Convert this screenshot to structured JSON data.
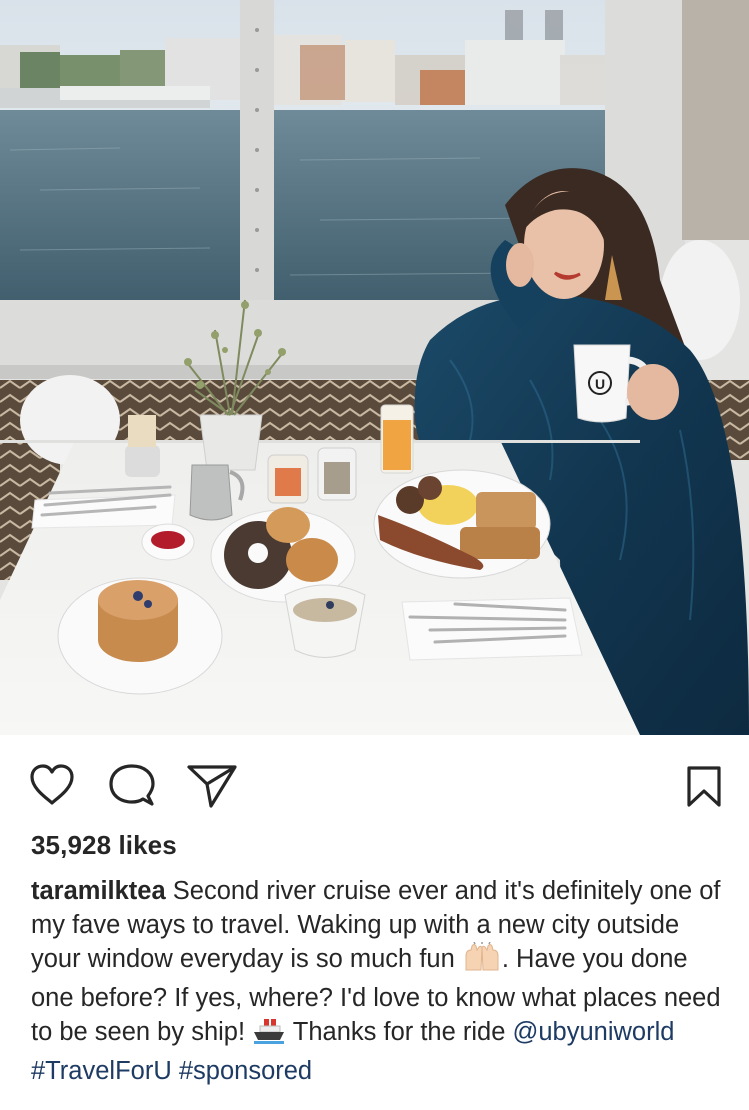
{
  "post": {
    "image": {
      "description_icon": "breakfast-photo"
    },
    "actions": {
      "like_icon": "heart-icon",
      "comment_icon": "comment-icon",
      "share_icon": "paper-plane-icon",
      "save_icon": "bookmark-icon"
    },
    "likes_text": "35,928 likes",
    "caption": {
      "username": "taramilktea",
      "text_part1": " Second river cruise ever and it's definitely one of my fave ways to travel. Waking up with a new city outside your window everyday is so much fun ",
      "emoji1": "raised-hands-emoji",
      "text_part2": ". Have you done one before? If yes, where? I'd love to know what places need to be seen by ship! ",
      "emoji2": "ship-emoji",
      "text_part3": " Thanks for the ride ",
      "mention": "@ubyuniworld",
      "hashtag1": "#TravelForU",
      "hashtag2": "#sponsored"
    },
    "mug_logo_letter": "U"
  },
  "colors": {
    "text": "#262626",
    "link": "#1e3b64",
    "icon": "#262626"
  }
}
